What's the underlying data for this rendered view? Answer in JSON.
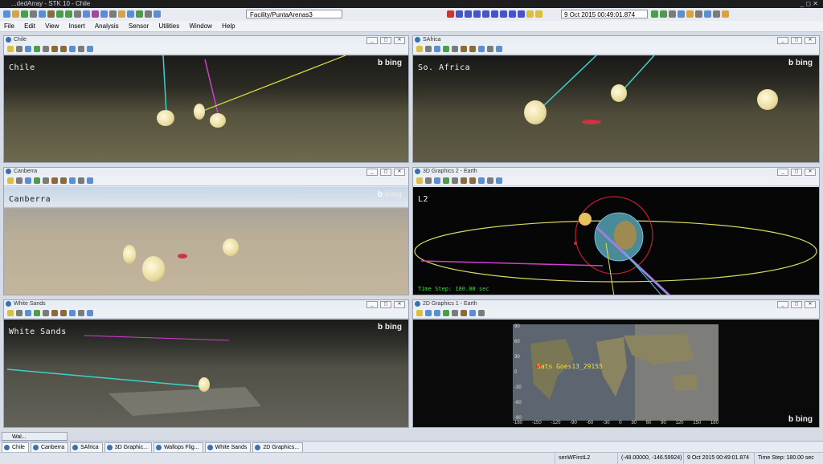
{
  "window": {
    "title": "...dedArray - STK 10 - Chile",
    "controls": "_ ◻ ✕"
  },
  "toolbar": {
    "facility_value": "Facility/PuntaArenas3",
    "time_value": "9 Oct 2015 00:49:01.874"
  },
  "menu": [
    "File",
    "Edit",
    "View",
    "Insert",
    "Analysis",
    "Sensor",
    "Utilities",
    "Window",
    "Help"
  ],
  "panes": {
    "chile": {
      "title": "Chile",
      "label": "Chile",
      "bing": "bing"
    },
    "safrica": {
      "title": "SAfrica",
      "label": "So. Africa",
      "bing": "bing"
    },
    "canberra": {
      "title": "Canberra",
      "label": "Canberra",
      "bing": "bing"
    },
    "graphics3d2": {
      "title": "3D Graphics 2 - Earth",
      "label": "L2",
      "status": "Time Step: 180.00 sec"
    },
    "whitesands": {
      "title": "White Sands",
      "label": "White Sands",
      "bing": "bing"
    },
    "graphics2d1": {
      "title": "2D Graphics 1 - Earth",
      "sat_label": "Sats Goes13_29155",
      "bing": "bing",
      "lon_ticks": [
        "-180",
        "-150",
        "-120",
        "-90",
        "-60",
        "-30",
        "0",
        "30",
        "60",
        "90",
        "120",
        "150",
        "180"
      ],
      "lat_ticks": [
        "-90",
        "-60",
        "-30",
        "0",
        "30",
        "60",
        "90"
      ]
    }
  },
  "floating_window": {
    "title": "Wal..."
  },
  "taskbar": [
    "Chile",
    "Canberra",
    "SAfrica",
    "3D Graphic...",
    "Wallops Flig...",
    "White Sands",
    "2D Graphics..."
  ],
  "statusbar": {
    "object": "senWFirstL2",
    "coords": "(-48.00000, -146.59924)",
    "time": "9 Oct 2015 00:49:01.874",
    "timestep": "Time Step: 180.00 sec"
  },
  "colors": {
    "accent": "#3a6fb0",
    "sky_dark": "#0b0b0b",
    "ground": "#6d6a4f",
    "ecliptic": "#e0e070"
  }
}
